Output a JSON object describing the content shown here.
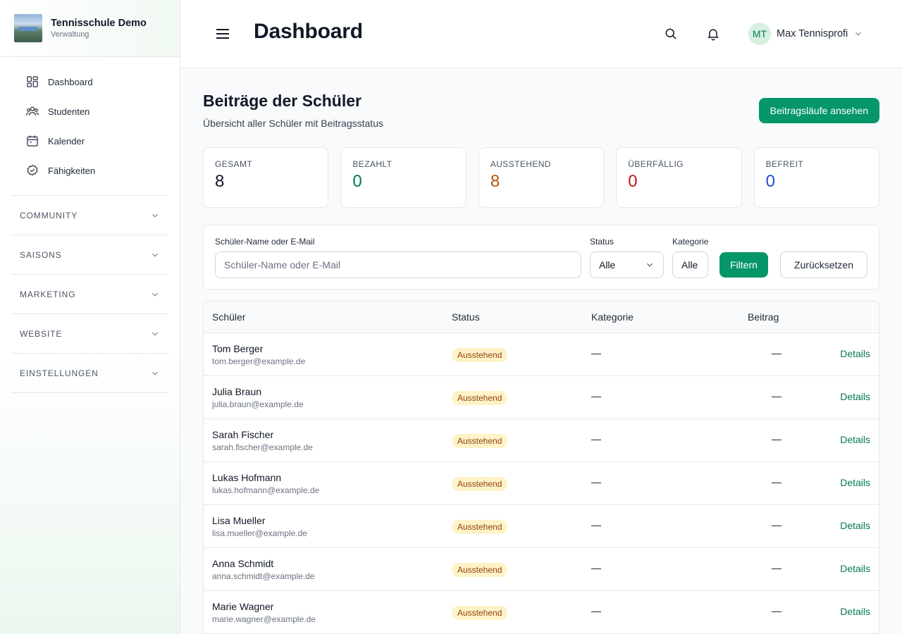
{
  "brand": {
    "title": "Tennisschule Demo",
    "subtitle": "Verwaltung"
  },
  "nav": {
    "items": [
      {
        "label": "Dashboard",
        "icon": "dashboard-grid-icon"
      },
      {
        "label": "Studenten",
        "icon": "users-icon"
      },
      {
        "label": "Kalender",
        "icon": "calendar-icon"
      },
      {
        "label": "Fähigkeiten",
        "icon": "check-circle-icon"
      }
    ],
    "sections": [
      "COMMUNITY",
      "SAISONS",
      "MARKETING",
      "WEBSITE",
      "EINSTELLUNGEN"
    ]
  },
  "header": {
    "title": "Dashboard",
    "user": {
      "initials": "MT",
      "name": "Max Tennisprofi"
    }
  },
  "main": {
    "title": "Beiträge der Schüler",
    "subtitle": "Übersicht aller Schüler mit Beitragsstatus",
    "primary_button": "Beitragsläufe ansehen"
  },
  "stats": [
    {
      "label": "GESAMT",
      "value": "8",
      "color": "#111827"
    },
    {
      "label": "BEZAHLT",
      "value": "0",
      "color": "#047857"
    },
    {
      "label": "AUSSTEHEND",
      "value": "8",
      "color": "#b45309"
    },
    {
      "label": "ÜBERFÄLLIG",
      "value": "0",
      "color": "#b91c1c"
    },
    {
      "label": "BEFREIT",
      "value": "0",
      "color": "#1d4ed8"
    }
  ],
  "filter": {
    "search_label": "Schüler-Name oder E-Mail",
    "search_placeholder": "Schüler-Name oder E-Mail",
    "status_label": "Status",
    "status_value": "Alle",
    "category_label": "Kategorie",
    "category_value": "Alle",
    "filter_button": "Filtern",
    "reset_button": "Zurücksetzen"
  },
  "table": {
    "headers": {
      "student": "Schüler",
      "status": "Status",
      "category": "Kategorie",
      "fee": "Beitrag"
    },
    "rows": [
      {
        "name": "Tom Berger",
        "email": "tom.berger@example.de",
        "status": "Ausstehend",
        "category": "—",
        "fee": "—",
        "action": "Details"
      },
      {
        "name": "Julia Braun",
        "email": "julia.braun@example.de",
        "status": "Ausstehend",
        "category": "—",
        "fee": "—",
        "action": "Details"
      },
      {
        "name": "Sarah Fischer",
        "email": "sarah.fischer@example.de",
        "status": "Ausstehend",
        "category": "—",
        "fee": "—",
        "action": "Details"
      },
      {
        "name": "Lukas Hofmann",
        "email": "lukas.hofmann@example.de",
        "status": "Ausstehend",
        "category": "—",
        "fee": "—",
        "action": "Details"
      },
      {
        "name": "Lisa Mueller",
        "email": "lisa.mueller@example.de",
        "status": "Ausstehend",
        "category": "—",
        "fee": "—",
        "action": "Details"
      },
      {
        "name": "Anna Schmidt",
        "email": "anna.schmidt@example.de",
        "status": "Ausstehend",
        "category": "—",
        "fee": "—",
        "action": "Details"
      },
      {
        "name": "Marie Wagner",
        "email": "marie.wagner@example.de",
        "status": "Ausstehend",
        "category": "—",
        "fee": "—",
        "action": "Details"
      }
    ]
  }
}
